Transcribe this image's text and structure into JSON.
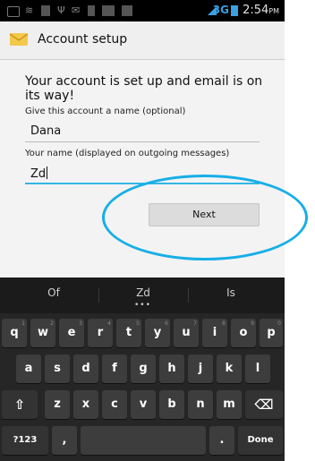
{
  "status_bar": {
    "network": "3G",
    "time": "2:54",
    "ampm": "PM"
  },
  "action_bar": {
    "title": "Account setup"
  },
  "content": {
    "headline": "Your account is set up and email is on its way!",
    "account_name_label": "Give this account a name (optional)",
    "account_name_value": "Dana",
    "your_name_label": "Your name (displayed on outgoing messages)",
    "your_name_value": "Zd",
    "next_label": "Next"
  },
  "keyboard": {
    "suggestions": [
      "Of",
      "Zd",
      "Is"
    ],
    "suggestion_dots": "•••",
    "row1": [
      {
        "label": "q",
        "hint": "1"
      },
      {
        "label": "w",
        "hint": "2"
      },
      {
        "label": "e",
        "hint": "3"
      },
      {
        "label": "r",
        "hint": "4"
      },
      {
        "label": "t",
        "hint": "5"
      },
      {
        "label": "y",
        "hint": "6"
      },
      {
        "label": "u",
        "hint": "7"
      },
      {
        "label": "i",
        "hint": "8"
      },
      {
        "label": "o",
        "hint": "9"
      },
      {
        "label": "p",
        "hint": "0"
      }
    ],
    "row2": [
      "a",
      "s",
      "d",
      "f",
      "g",
      "h",
      "j",
      "k",
      "l"
    ],
    "row3": [
      "z",
      "x",
      "c",
      "v",
      "b",
      "n",
      "m"
    ],
    "shift_symbol": "⇧",
    "backspace_symbol": "⌫",
    "symbols_label": "?123",
    "comma_label": ",",
    "period_label": ".",
    "done_label": "Done"
  }
}
